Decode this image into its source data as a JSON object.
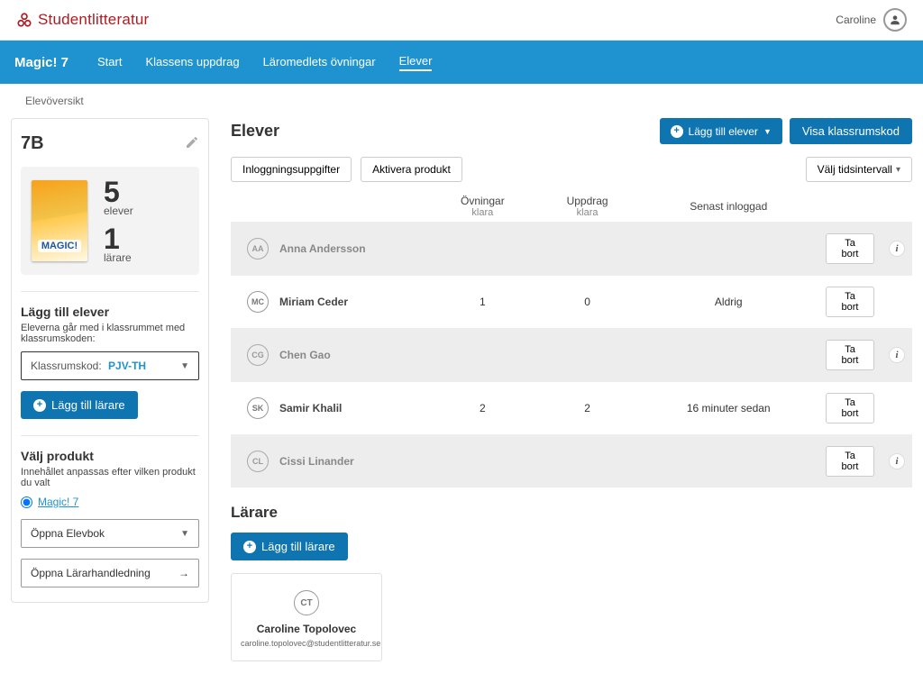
{
  "header": {
    "brand": "Studentlitteratur",
    "user_name": "Caroline"
  },
  "nav": {
    "product": "Magic! 7",
    "items": [
      "Start",
      "Klassens uppdrag",
      "Läromedlets övningar",
      "Elever"
    ],
    "active_index": 3
  },
  "breadcrumb": "Elevöversikt",
  "sidebar": {
    "class_name": "7B",
    "cover_title": "MAGIC!",
    "students_count": "5",
    "students_label": "elever",
    "teachers_count": "1",
    "teachers_label": "lärare",
    "add_students_title": "Lägg till elever",
    "add_students_desc": "Eleverna går med i klassrummet med klassrumskoden:",
    "code_label": "Klassrumskod:",
    "code_value": "PJV-TH",
    "add_teacher_btn": "Lägg till lärare",
    "choose_product_title": "Välj produkt",
    "choose_product_desc": "Innehållet anpassas efter vilken produkt du valt",
    "product_radio": "Magic! 7",
    "open_elevbok": "Öppna Elevbok",
    "open_lararhandledning": "Öppna Lärarhandledning"
  },
  "main": {
    "title": "Elever",
    "add_elev_btn": "Lägg till elever",
    "show_code_btn": "Visa klassrumskod",
    "chip_login": "Inloggningsuppgifter",
    "chip_activate": "Aktivera produkt",
    "time_filter": "Välj tidsintervall",
    "columns": {
      "ovningar": "Övningar",
      "ovningar_sub": "klara",
      "uppdrag": "Uppdrag",
      "uppdrag_sub": "klara",
      "senast": "Senast inloggad"
    },
    "remove_label": "Ta bort",
    "rows": [
      {
        "initials": "AA",
        "name": "Anna Andersson",
        "ovningar": "",
        "uppdrag": "",
        "senast": "",
        "shaded": true,
        "info": true
      },
      {
        "initials": "MC",
        "name": "Miriam Ceder",
        "ovningar": "1",
        "uppdrag": "0",
        "senast": "Aldrig",
        "shaded": false,
        "info": false
      },
      {
        "initials": "CG",
        "name": "Chen Gao",
        "ovningar": "",
        "uppdrag": "",
        "senast": "",
        "shaded": true,
        "info": true
      },
      {
        "initials": "SK",
        "name": "Samir Khalil",
        "ovningar": "2",
        "uppdrag": "2",
        "senast": "16 minuter sedan",
        "shaded": false,
        "info": false
      },
      {
        "initials": "CL",
        "name": "Cissi Linander",
        "ovningar": "",
        "uppdrag": "",
        "senast": "",
        "shaded": true,
        "info": true
      }
    ],
    "larare_title": "Lärare",
    "add_larare_btn": "Lägg till lärare",
    "teacher": {
      "initials": "CT",
      "name": "Caroline Topolovec",
      "email": "caroline.topolovec@studentlitteratur.se"
    }
  }
}
